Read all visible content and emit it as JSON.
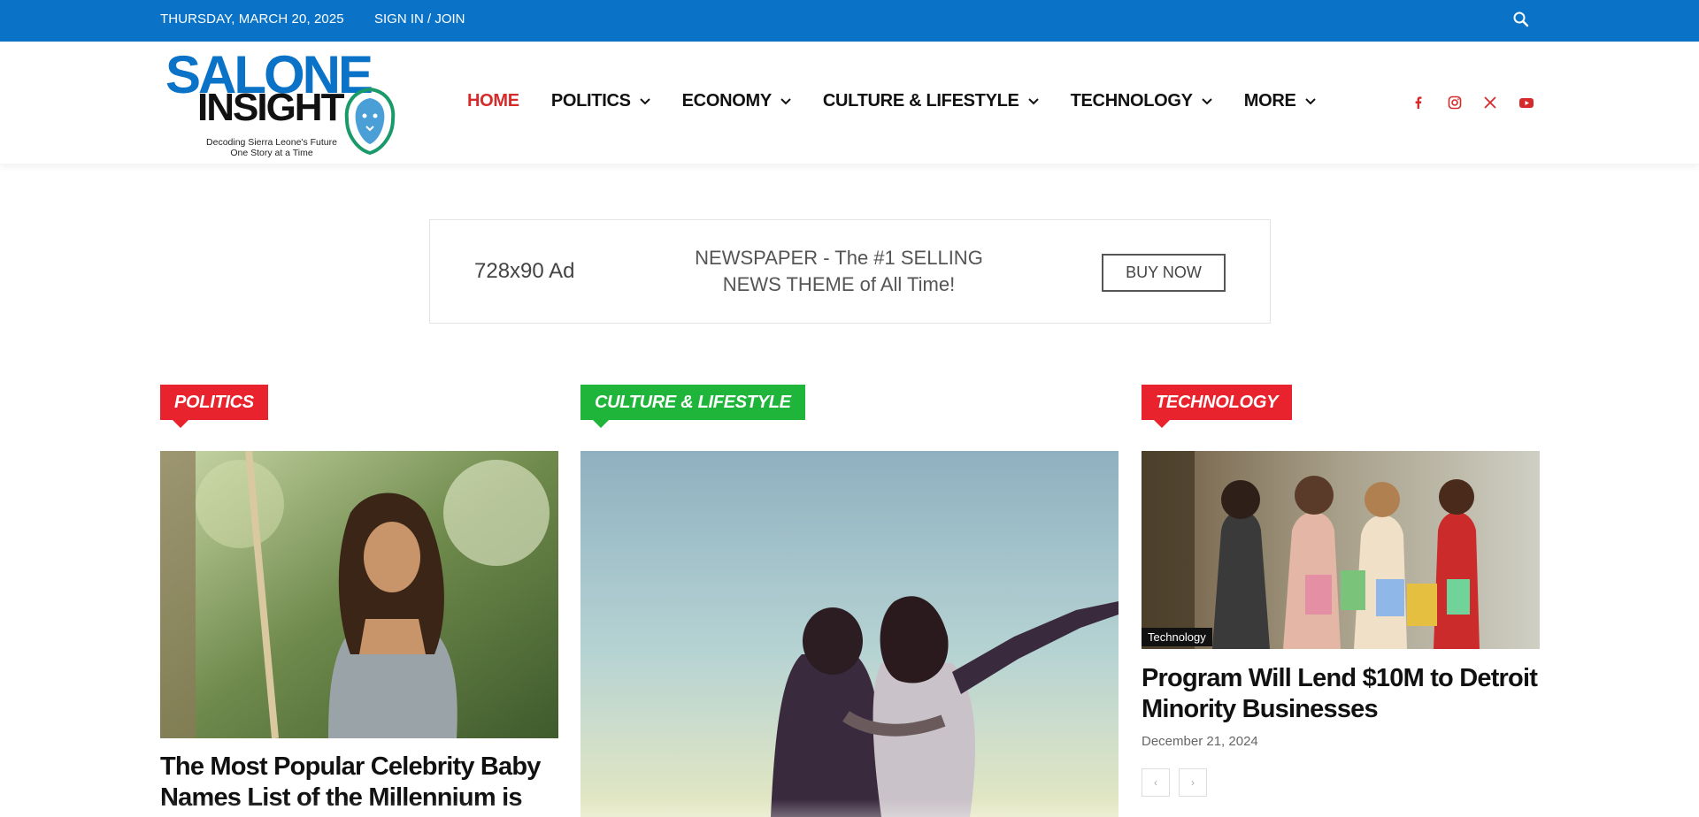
{
  "topbar": {
    "date": "THURSDAY, MARCH 20, 2025",
    "signin": "SIGN IN / JOIN",
    "search_icon": "search-icon"
  },
  "logo": {
    "line1": "SALONE",
    "line2": "INSIGHT",
    "tagline1": "Decoding Sierra Leone's Future",
    "tagline2": "One Story at a Time"
  },
  "nav": {
    "items": [
      {
        "label": "HOME",
        "active": true
      },
      {
        "label": "POLITICS",
        "dropdown": true
      },
      {
        "label": "ECONOMY",
        "dropdown": true
      },
      {
        "label": "CULTURE & LIFESTYLE",
        "dropdown": true
      },
      {
        "label": "TECHNOLOGY",
        "dropdown": true
      },
      {
        "label": "MORE",
        "dropdown": true
      }
    ]
  },
  "social": [
    "facebook-icon",
    "instagram-icon",
    "x-icon",
    "youtube-icon"
  ],
  "ad": {
    "size": "728x90 Ad",
    "line1": "NEWSPAPER - The #1 SELLING",
    "line2": "NEWS THEME of All Time!",
    "button": "BUY NOW"
  },
  "sections": {
    "politics": {
      "label": "POLITICS",
      "headline_line1": "The Most Popular Celebrity Baby",
      "headline_line2": "Names List of the Millennium is"
    },
    "culture": {
      "label": "CULTURE & LIFESTYLE"
    },
    "technology": {
      "label": "TECHNOLOGY",
      "tag": "Technology",
      "headline_line1": "Program Will Lend $10M to Detroit",
      "headline_line2": "Minority Businesses",
      "date": "December 21, 2024",
      "prev": "‹",
      "next": "›"
    }
  },
  "colors": {
    "topbar": "#0a73c8",
    "accent_red": "#e8232d",
    "accent_green": "#1fb43a",
    "nav_active": "#d62b2b"
  }
}
